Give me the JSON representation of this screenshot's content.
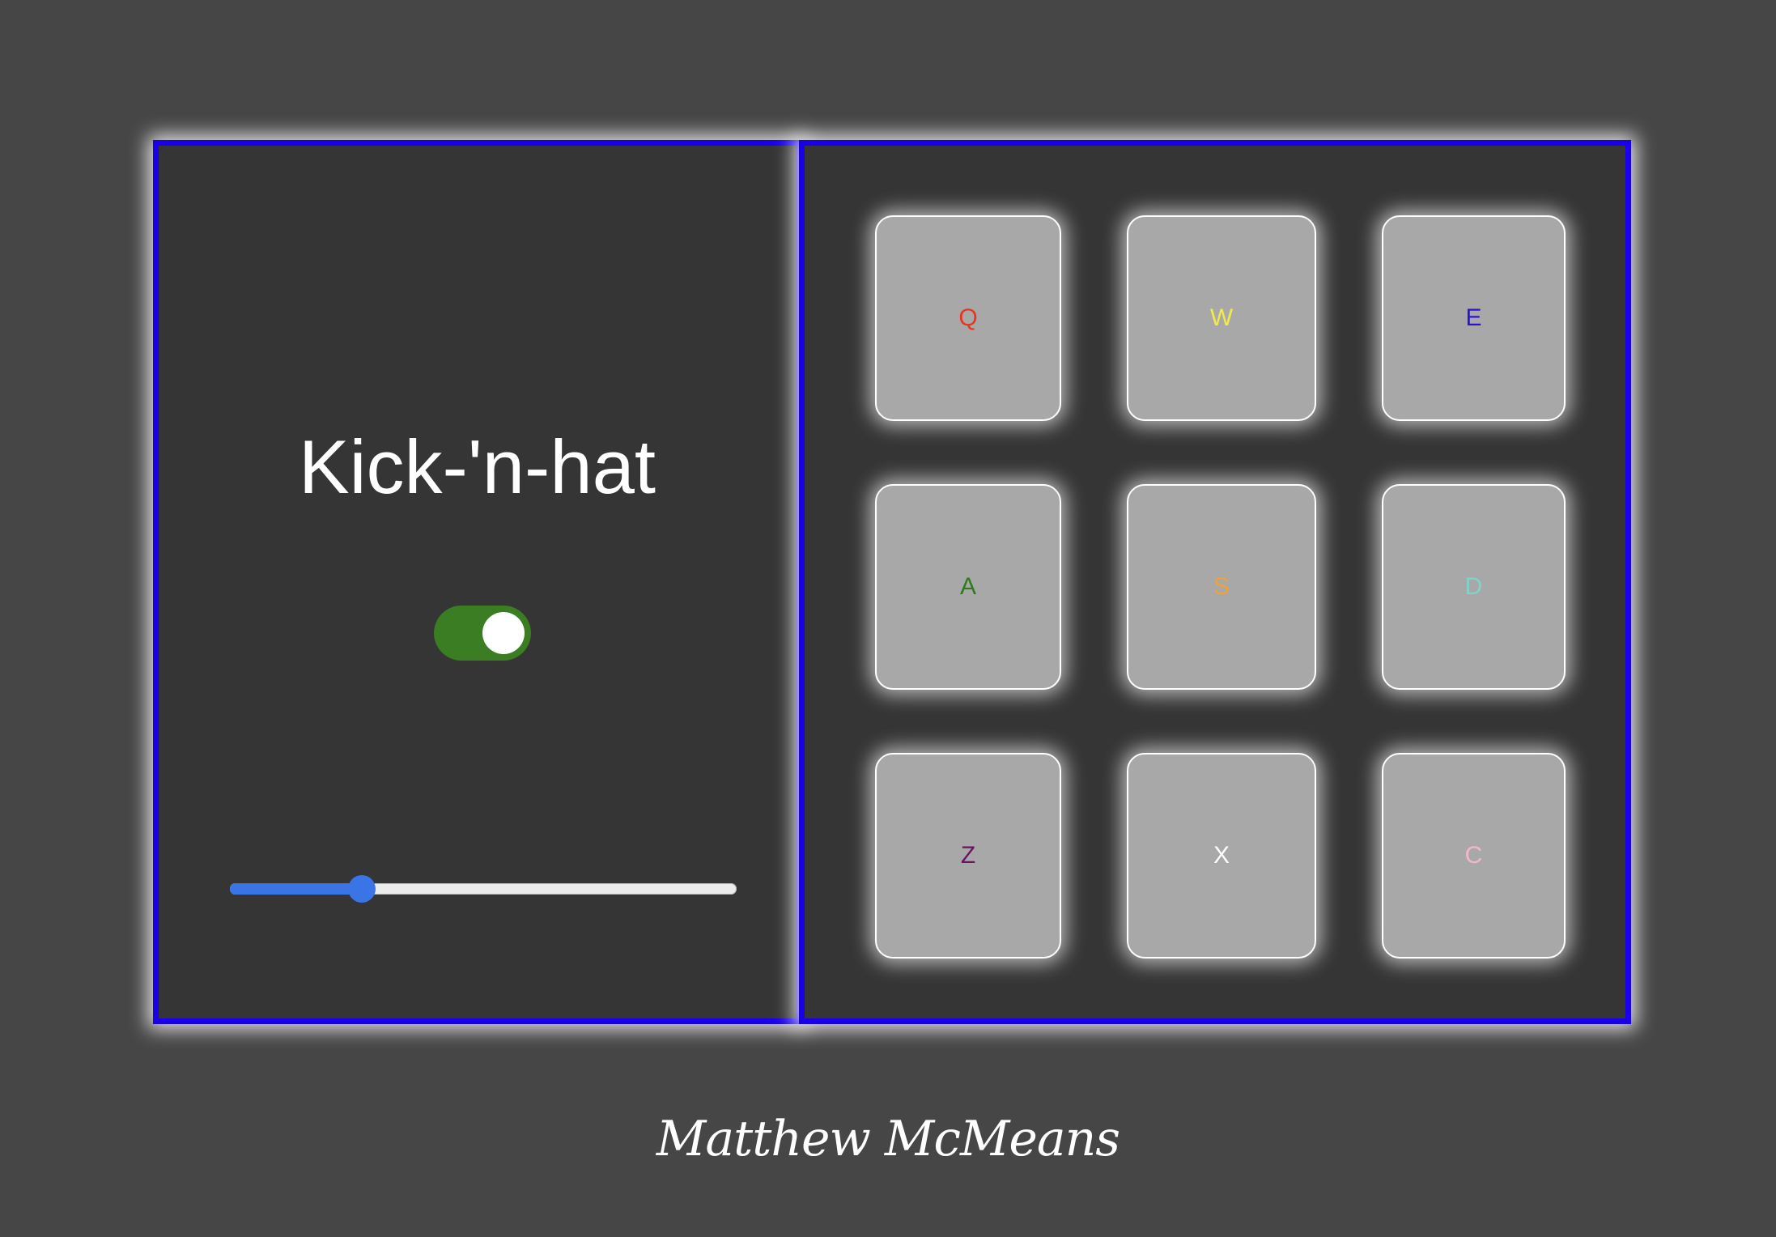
{
  "app": {
    "title": "Kick-'n-hat"
  },
  "controls": {
    "power_toggle": {
      "state": "on",
      "color": "#3a7d22"
    },
    "volume_slider": {
      "value": 0.26,
      "color": "#3b74e6"
    }
  },
  "pads": [
    {
      "key": "Q",
      "color": "#e8351e"
    },
    {
      "key": "W",
      "color": "#f2e94a"
    },
    {
      "key": "E",
      "color": "#2a12d6"
    },
    {
      "key": "A",
      "color": "#2f7a1f"
    },
    {
      "key": "S",
      "color": "#f0a13a"
    },
    {
      "key": "D",
      "color": "#7fd3c8"
    },
    {
      "key": "Z",
      "color": "#6b1260"
    },
    {
      "key": "X",
      "color": "#ffffff"
    },
    {
      "key": "C",
      "color": "#f2b8c8"
    }
  ],
  "footer": {
    "signature": "Matthew McMeans"
  },
  "theme": {
    "panel_border": "#1a00e8",
    "panel_bg": "#353535",
    "page_bg": "#464646",
    "pad_bg": "#a8a8a8"
  }
}
